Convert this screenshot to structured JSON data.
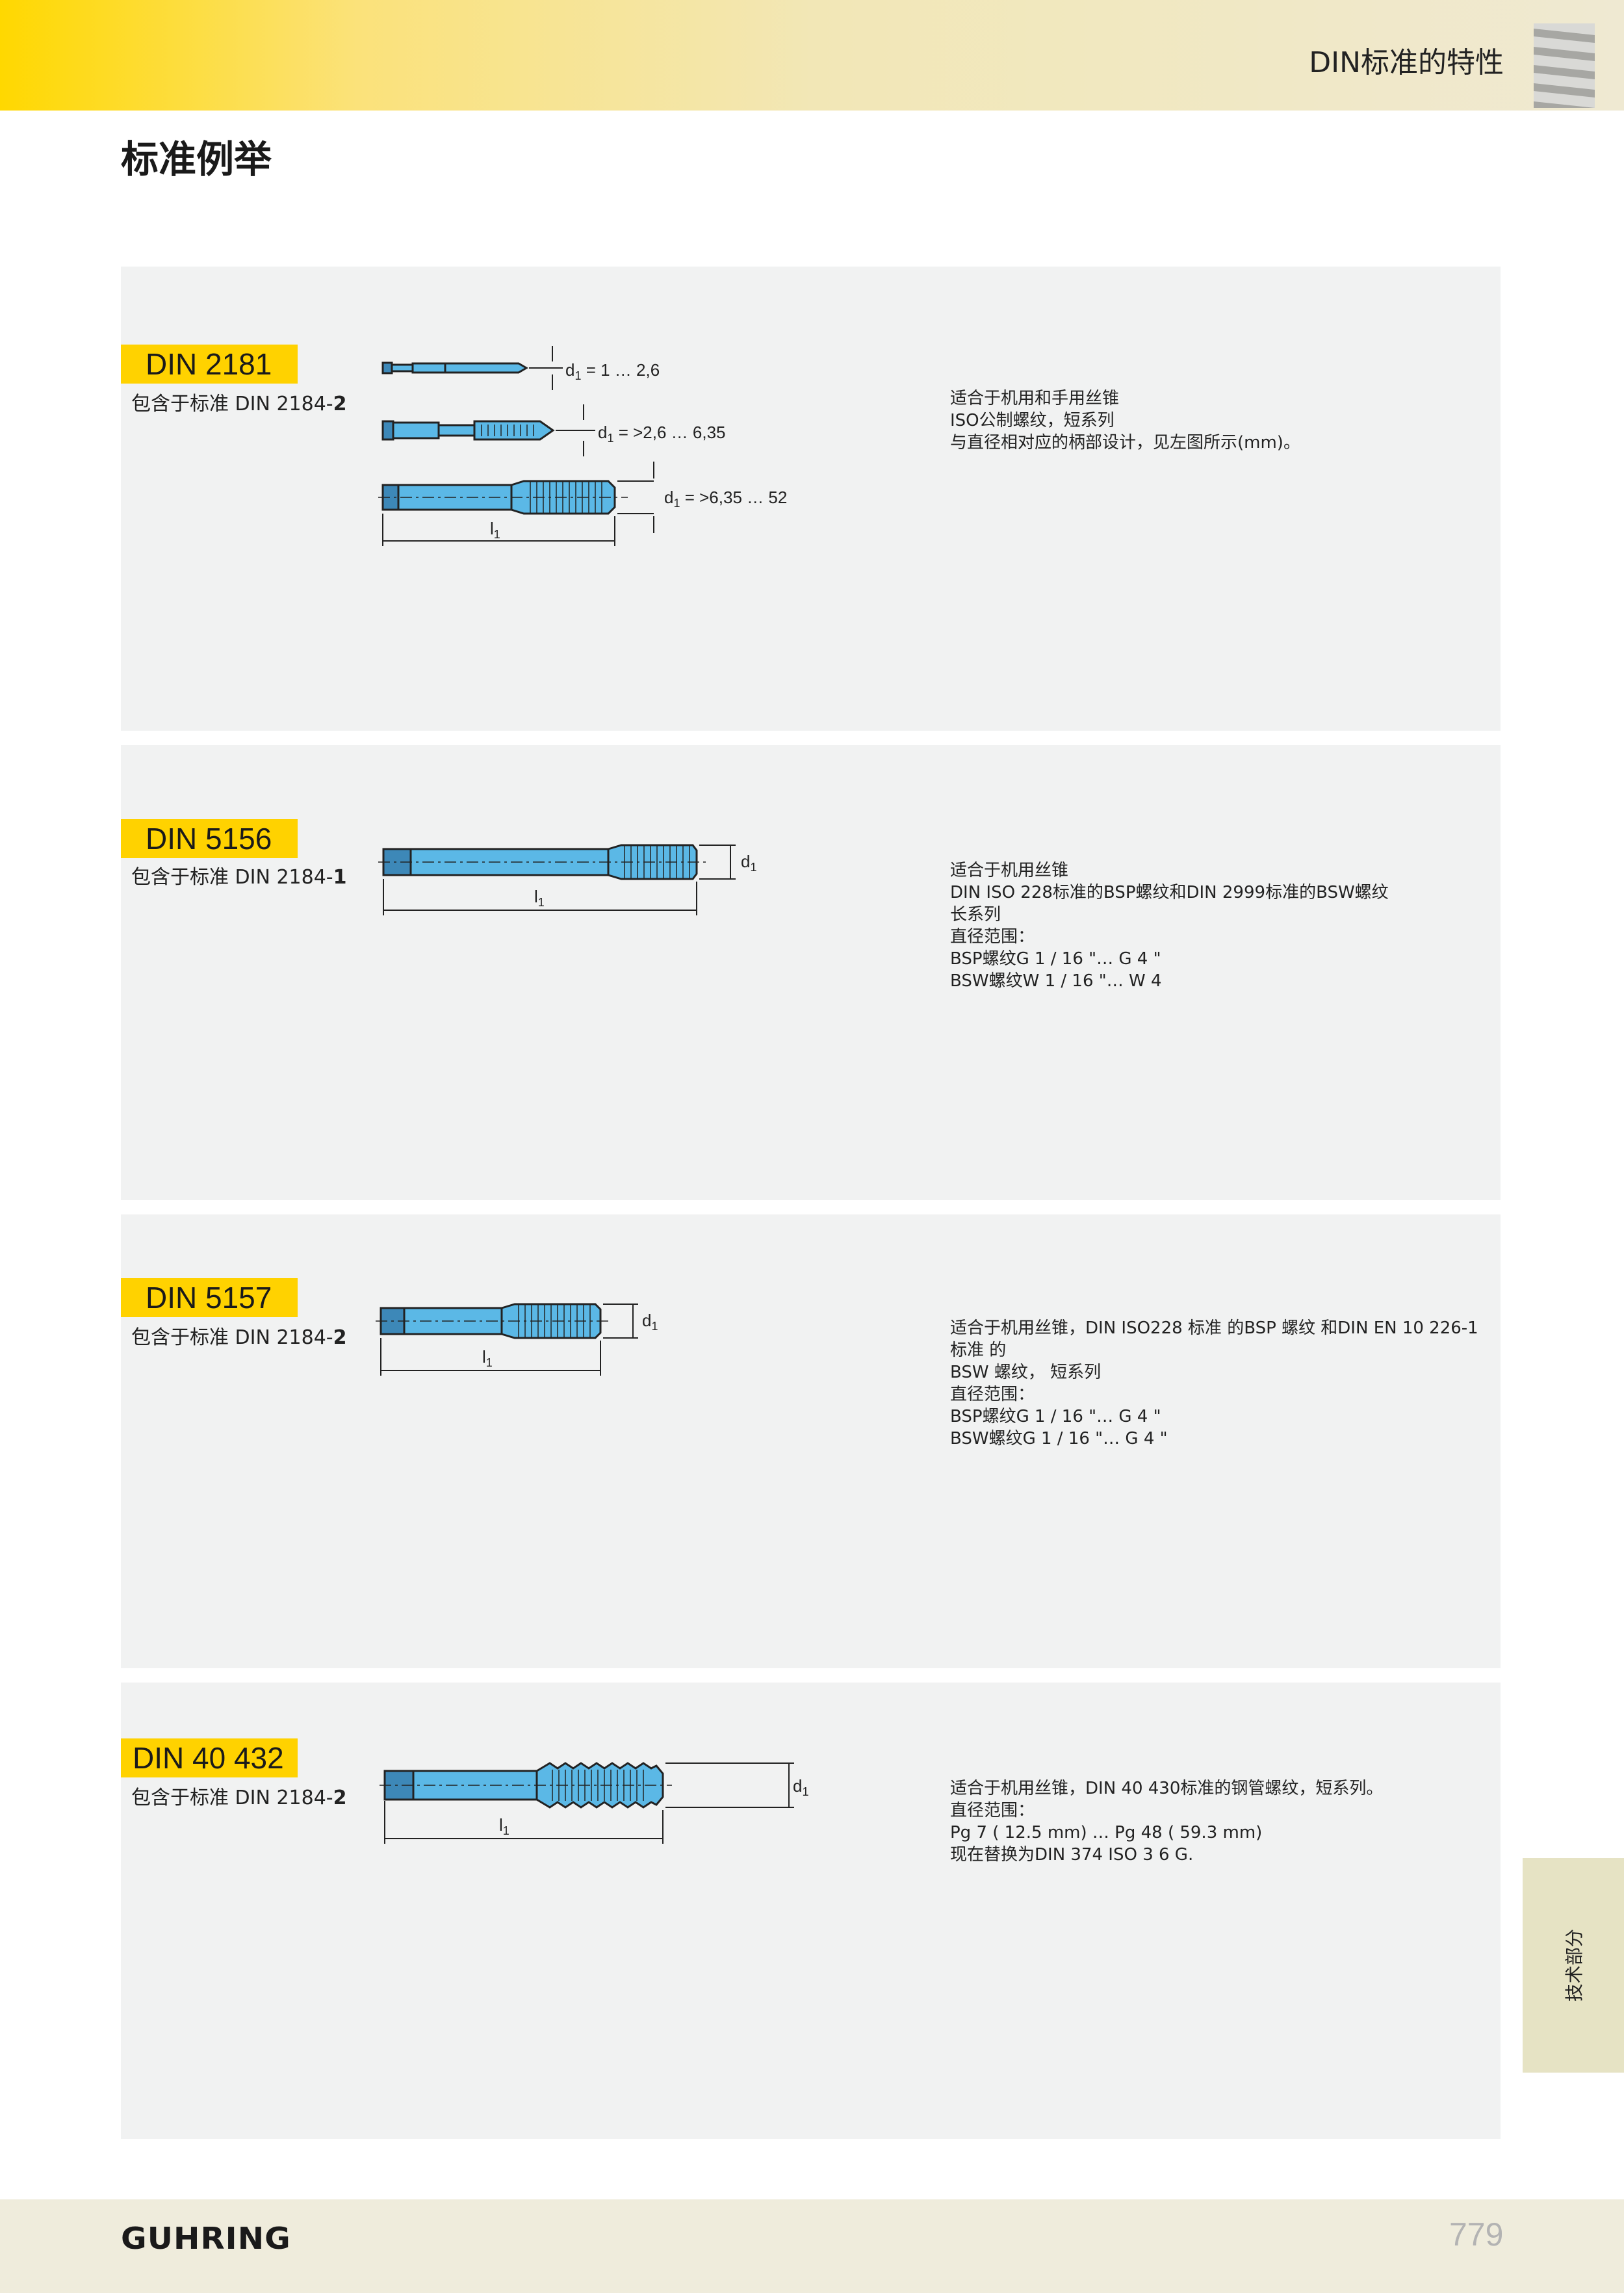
{
  "header": {
    "title": "DIN标准的特性"
  },
  "page_title": "标准例举",
  "sections": [
    {
      "standard": "DIN 2181",
      "included_prefix": "包含于标准 DIN 2184-",
      "included_part": "2",
      "dims": [
        "1 … 2,6",
        "= >2,6 … 6,35",
        "= >6,35 … 52"
      ],
      "desc": [
        "适合于机用和手用丝锥",
        "ISO公制螺纹，短系列",
        "与直径相对应的柄部设计，见左图所示(mm)。"
      ]
    },
    {
      "standard": "DIN 5156",
      "included_prefix": "包含于标准 DIN 2184-",
      "included_part": "1",
      "desc": [
        "适合于机用丝锥",
        "DIN ISO 228标准的BSP螺纹和DIN 2999标准的BSW螺纹",
        "长系列",
        "直径范围：",
        "BSP螺纹G    1  /  16      \"… G    4      \"",
        "BSW螺纹W     1  /  16      \"… W    4"
      ]
    },
    {
      "standard": "DIN 5157",
      "included_prefix": "包含于标准 DIN 2184-",
      "included_part": "2",
      "desc": [
        "适合于机用丝锥，DIN ISO228 标准 的BSP 螺纹 和DIN EN 10 226-1",
        "标准 的",
        "BSW 螺纹，  短系列",
        "直径范围：",
        "BSP螺纹G    1  /  16      \"… G    4      \"",
        "BSW螺纹G    1  /  16      \"… G    4      \""
      ]
    },
    {
      "standard": "DIN 40 432",
      "included_prefix": "包含于标准 DIN 2184-",
      "included_part": "2",
      "desc": [
        "适合于机用丝锥，DIN 40 430标准的钢管螺纹，短系列。",
        "直径范围：",
        "Pg    7    (    12.5    mm) … Pg    48    (    59.3    mm)",
        "现在替换为DIN    374    ISO    3      6  G."
      ]
    }
  ],
  "dim_labels": {
    "d": "d",
    "sub": "1",
    "l": "l"
  },
  "side_tab": "技术部分",
  "footer": {
    "logo": "GUHRING",
    "page": "779"
  },
  "colors": {
    "accent": "#ffd200",
    "tool": "#5bb8e6",
    "panel": "#f1f2f2"
  }
}
